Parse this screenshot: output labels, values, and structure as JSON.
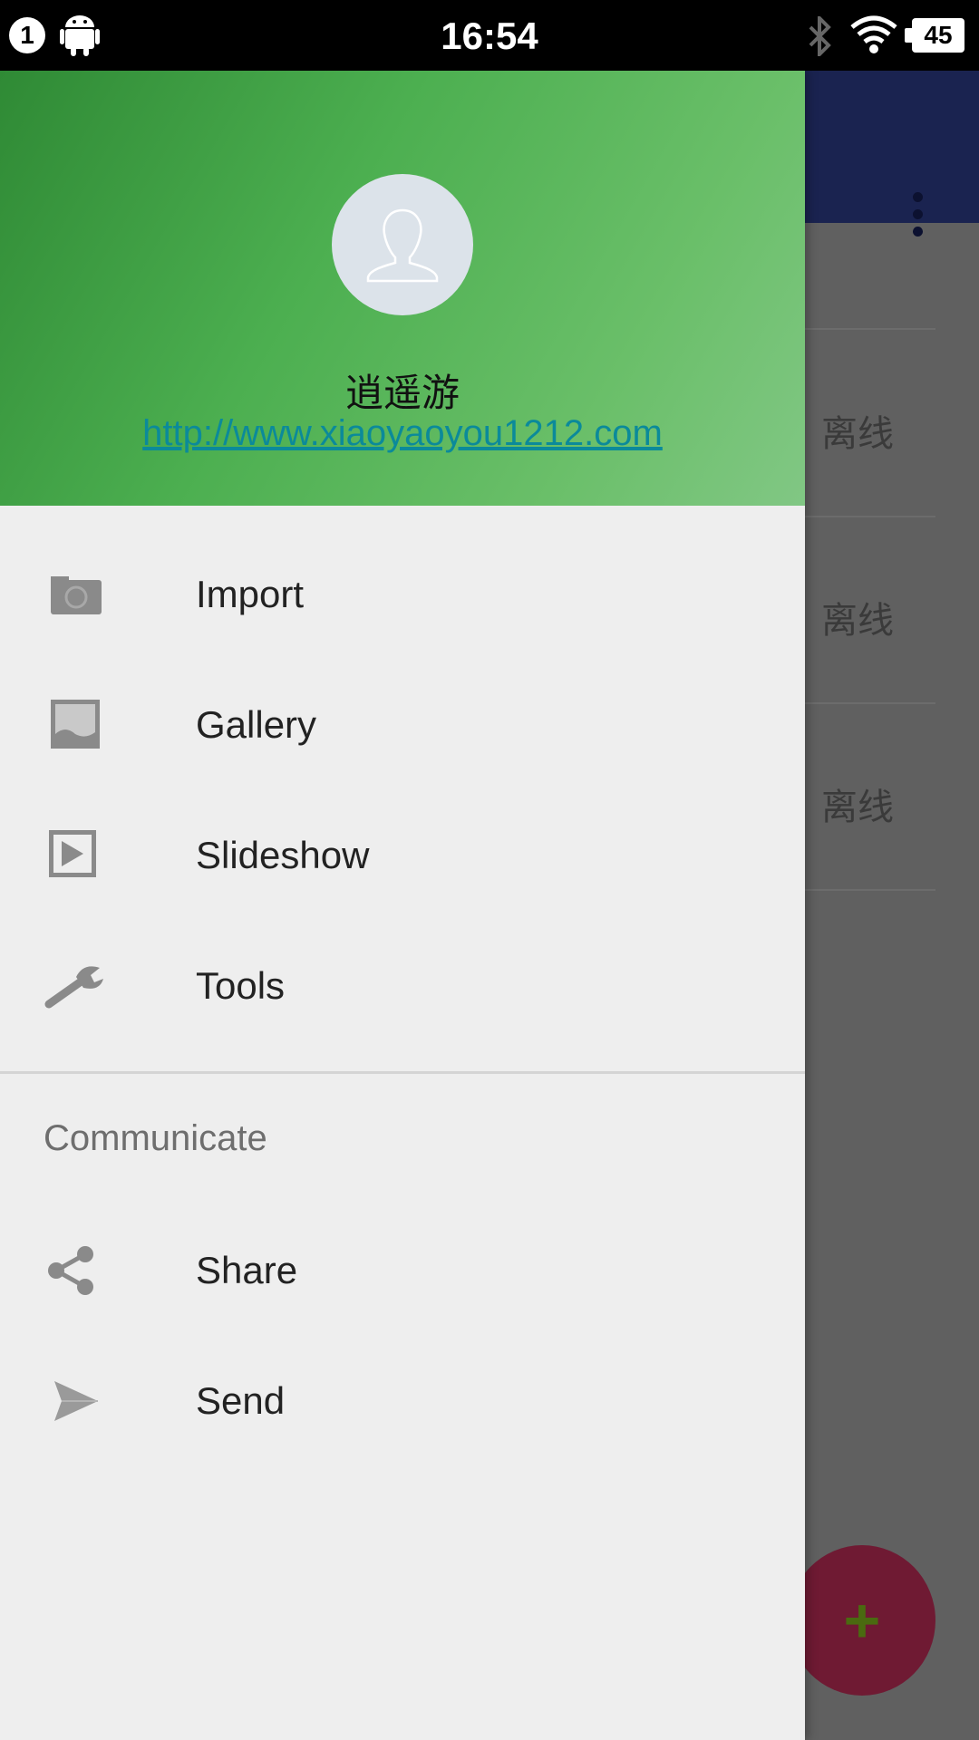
{
  "status_bar": {
    "notification_count": "1",
    "time": "16:54",
    "battery": "45"
  },
  "background_app": {
    "rows": [
      "离线",
      "离线",
      "离线"
    ],
    "fab_label": "+"
  },
  "drawer": {
    "header": {
      "name": "逍遥游",
      "url": "http://www.xiaoyaoyou1212.com",
      "gradient_colors": [
        "#2f8a35",
        "#81c784"
      ]
    },
    "items": [
      {
        "label": "Import",
        "icon": "camera-icon"
      },
      {
        "label": "Gallery",
        "icon": "gallery-icon"
      },
      {
        "label": "Slideshow",
        "icon": "slideshow-icon"
      },
      {
        "label": "Tools",
        "icon": "wrench-icon"
      }
    ],
    "section_title": "Communicate",
    "section_items": [
      {
        "label": "Share",
        "icon": "share-icon"
      },
      {
        "label": "Send",
        "icon": "send-icon"
      }
    ]
  },
  "colors": {
    "toolbar": "#1a2350",
    "fab": "#6f1a33",
    "icon_gray": "#8a8a8a"
  }
}
